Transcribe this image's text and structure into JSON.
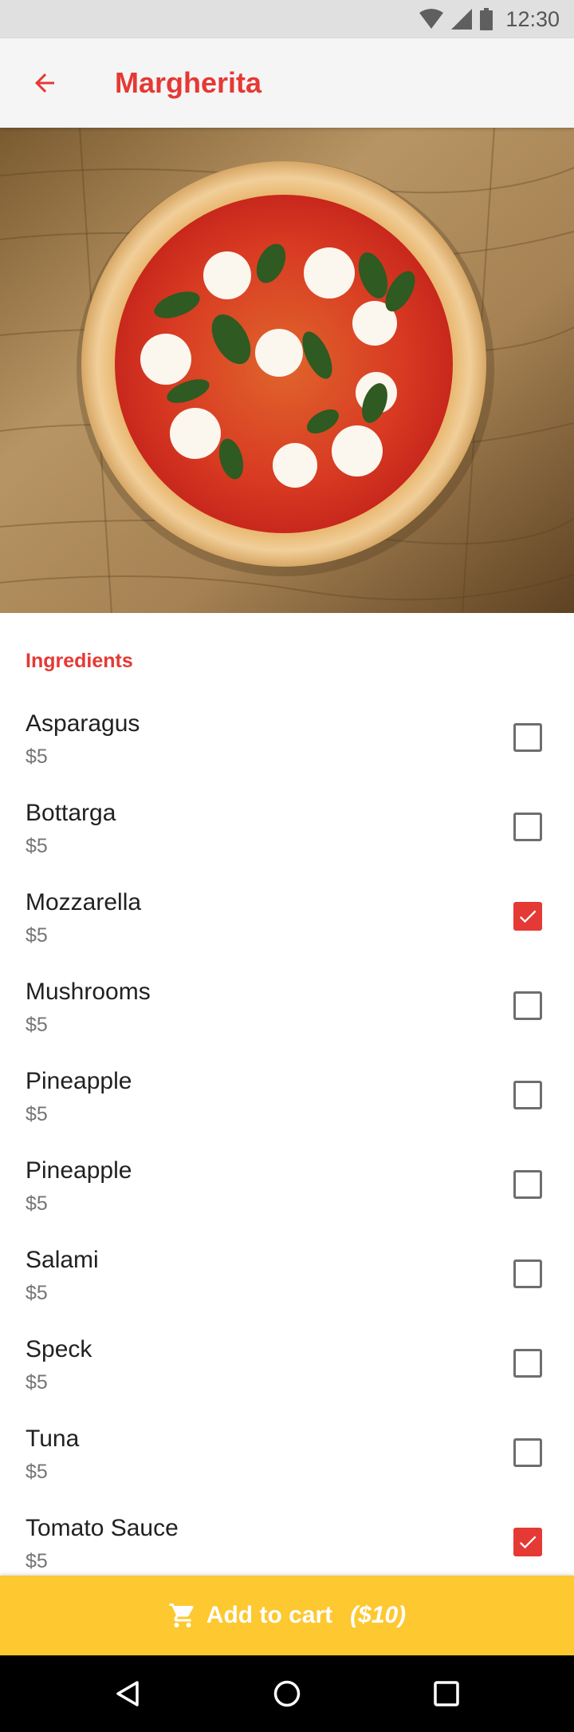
{
  "status_bar": {
    "time": "12:30",
    "icons": [
      "wifi-icon",
      "signal-icon",
      "battery-icon"
    ]
  },
  "app_bar": {
    "title": "Margherita",
    "back_icon": "arrow-left-icon"
  },
  "hero": {
    "image": "margherita-pizza-photo"
  },
  "ingredients": {
    "header": "Ingredients",
    "items": [
      {
        "name": "Asparagus",
        "price": "$5",
        "checked": false
      },
      {
        "name": "Bottarga",
        "price": "$5",
        "checked": false
      },
      {
        "name": "Mozzarella",
        "price": "$5",
        "checked": true
      },
      {
        "name": "Mushrooms",
        "price": "$5",
        "checked": false
      },
      {
        "name": "Pineapple",
        "price": "$5",
        "checked": false
      },
      {
        "name": "Pineapple",
        "price": "$5",
        "checked": false
      },
      {
        "name": "Salami",
        "price": "$5",
        "checked": false
      },
      {
        "name": "Speck",
        "price": "$5",
        "checked": false
      },
      {
        "name": "Tuna",
        "price": "$5",
        "checked": false
      },
      {
        "name": "Tomato Sauce",
        "price": "$5",
        "checked": true
      }
    ]
  },
  "cart": {
    "label": "Add to cart",
    "price": "($10)",
    "icon": "shopping-cart-icon"
  },
  "nav_bar": {
    "icons": [
      "back-triangle-icon",
      "home-circle-icon",
      "recents-square-icon"
    ]
  },
  "colors": {
    "accent": "#e53935",
    "cart": "#fdc830",
    "app_bar": "#f5f5f5",
    "status_bar": "#e0e0e0"
  }
}
